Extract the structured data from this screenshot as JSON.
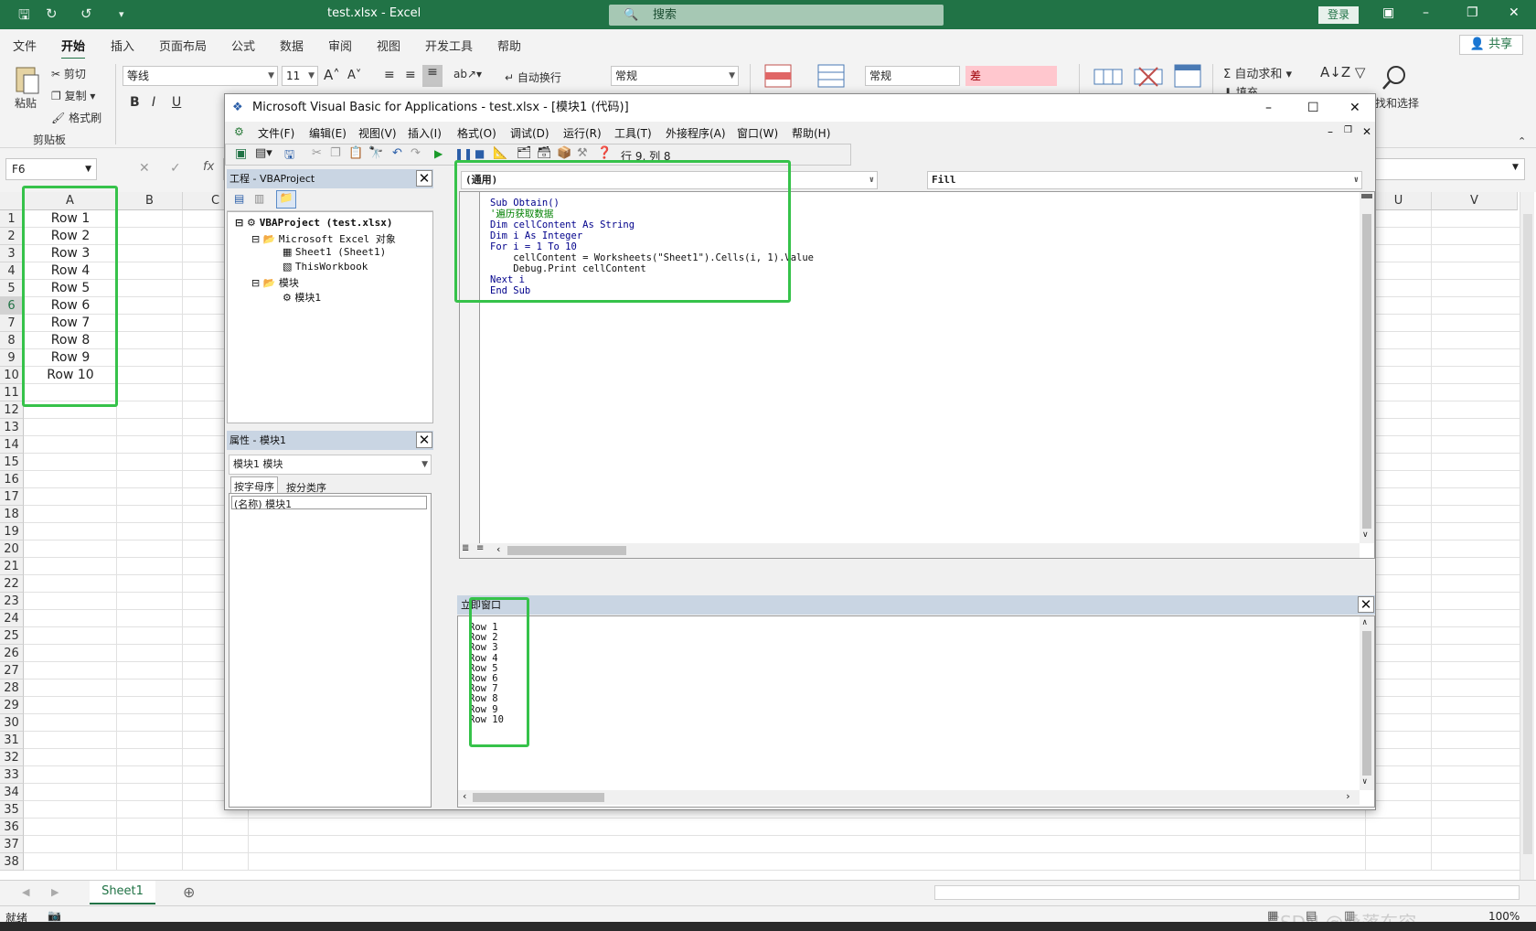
{
  "window": {
    "title": "test.xlsx  -  Excel",
    "search_placeholder": "搜索",
    "login_label": "登录"
  },
  "ribbon_tabs": [
    "文件",
    "开始",
    "插入",
    "页面布局",
    "公式",
    "数据",
    "审阅",
    "视图",
    "开发工具",
    "帮助"
  ],
  "active_tab": "开始",
  "share_label": "共享",
  "ribbon": {
    "paste": "粘贴",
    "cut": "剪切",
    "copy": "复制",
    "format_painter": "格式刷",
    "clipboard_group": "剪贴板",
    "font_name": "等线",
    "font_size": "11",
    "bold": "B",
    "italic": "I",
    "underline": "U",
    "wrap_text": "自动换行",
    "number_format": "常规",
    "style_normal": "常规",
    "style_bad": "差",
    "autosum": "自动求和",
    "fill": "填充",
    "find_select": "找和选择"
  },
  "formula_bar": {
    "name_box": "F6",
    "fx": "fx"
  },
  "sheet": {
    "columns": [
      "A",
      "B",
      "C",
      "U",
      "V"
    ],
    "row_numbers": [
      "1",
      "2",
      "3",
      "4",
      "5",
      "6",
      "7",
      "8",
      "9",
      "10",
      "11",
      "12",
      "13",
      "14",
      "15",
      "16",
      "17",
      "18",
      "19",
      "20",
      "21",
      "22",
      "23",
      "24",
      "25",
      "26",
      "27",
      "28",
      "29",
      "30",
      "31",
      "32",
      "33",
      "34",
      "35",
      "36",
      "37",
      "38"
    ],
    "column_a_values": [
      "Row 1",
      "Row 2",
      "Row 3",
      "Row 4",
      "Row 5",
      "Row 6",
      "Row 7",
      "Row 8",
      "Row 9",
      "Row 10"
    ],
    "sheet_tab": "Sheet1"
  },
  "status": {
    "ready": "就绪",
    "zoom": "100%",
    "watermark": "CSDN @桑落东容"
  },
  "vba": {
    "title": "Microsoft Visual Basic for Applications - test.xlsx - [模块1 (代码)]",
    "menu": [
      "文件(F)",
      "编辑(E)",
      "视图(V)",
      "插入(I)",
      "格式(O)",
      "调试(D)",
      "运行(R)",
      "工具(T)",
      "外接程序(A)",
      "窗口(W)",
      "帮助(H)"
    ],
    "cursor_pos": "行 9, 列 8",
    "project_pane": {
      "title": "工程 - VBAProject",
      "tree": [
        "VBAProject (test.xlsx)",
        "Microsoft Excel 对象",
        "Sheet1 (Sheet1)",
        "ThisWorkbook",
        "模块",
        "模块1"
      ]
    },
    "properties_pane": {
      "title": "属性 - 模块1",
      "object": "模块1 模块",
      "tabs": [
        "按字母序",
        "按分类序"
      ],
      "name_row": "(名称) 模块1"
    },
    "code": {
      "object_combo": "(通用)",
      "proc_combo": "Fill",
      "lines": [
        {
          "type": "kw",
          "text": "Sub Obtain()"
        },
        {
          "type": "cm",
          "text": "'遍历获取数据"
        },
        {
          "type": "kw",
          "text": "Dim cellContent As String"
        },
        {
          "type": "kw",
          "text": "Dim i As Integer"
        },
        {
          "type": "kw",
          "text": "For i = 1 To 10"
        },
        {
          "type": "plain",
          "text": "    cellContent = Worksheets(\"Sheet1\").Cells(i, 1).Value"
        },
        {
          "type": "plain",
          "text": "    Debug.Print cellContent"
        },
        {
          "type": "kw",
          "text": "Next i"
        },
        {
          "type": "kw",
          "text": "End Sub"
        }
      ]
    },
    "immediate": {
      "title": "立即窗口",
      "lines": [
        "Row 1",
        "Row 2",
        "Row 3",
        "Row 4",
        "Row 5",
        "Row 6",
        "Row 7",
        "Row 8",
        "Row 9",
        "Row 10"
      ]
    }
  },
  "colors": {
    "excel_green": "#217346",
    "highlight_box": "#36c24a",
    "bad_fill": "#ffc7ce"
  }
}
